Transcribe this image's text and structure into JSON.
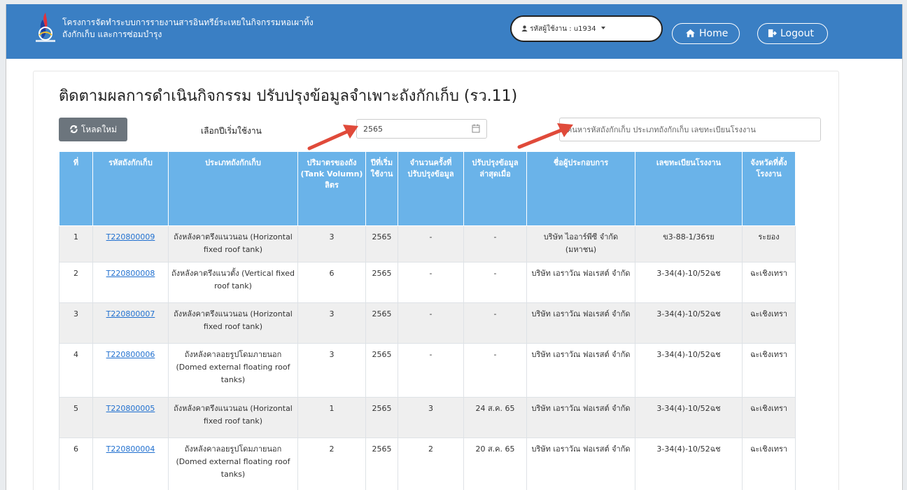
{
  "header": {
    "title_line1": "โครงการจัดทำระบบการรายงานสารอินทรีย์ระเหยในกิจกรรมหอเผาทิ้ง",
    "title_line2": "ถังกักเก็บ และการซ่อมบำรุง",
    "user_label": "รหัสผู้ใช้งาน : u1934",
    "home_label": "Home",
    "logout_label": "Logout",
    "bar_color": "#3a7fc4"
  },
  "page": {
    "title": "ติดตามผลการดำเนินกิจกรรม ปรับปรุงข้อมูลจำเพาะถังกักเก็บ (รว.11)"
  },
  "toolbar": {
    "reload_label": "โหลดใหม่",
    "year_label": "เลือกปีเริ่มใช้งาน",
    "year_value": "2565",
    "search_placeholder": "ค้นหารหัสถังกักเก็บ ประเภทถังกักเก็บ เลขทะเบียนโรงงาน"
  },
  "table": {
    "header_color": "#6ab3e9",
    "columns": [
      "ที่",
      "รหัสถังกักเก็บ",
      "ประเภทถังกักเก็บ",
      "ปริมาตรของถัง (Tank Volumn) ลิตร",
      "ปีที่เริ่มใช้งาน",
      "จำนวนครั้งที่ปรับปรุงข้อมูล",
      "ปรับปรุงข้อมูลล่าสุดเมื่อ",
      "ชื่อผู้ประกอบการ",
      "เลขทะเบียนโรงงาน",
      "จังหวัดที่ตั้งโรงงาน"
    ],
    "rows": [
      {
        "no": "1",
        "code": "T220800009",
        "type": "ถังหลังคาตรึงแนวนอน (Horizontal fixed roof tank)",
        "volume": "3",
        "year": "2565",
        "times": "-",
        "last": "-",
        "company": "บริษัท ไออาร์พีซี จำกัด (มหาชน)",
        "reg": "ข3-88-1/36รย",
        "province": "ระยอง"
      },
      {
        "no": "2",
        "code": "T220800008",
        "type": "ถังหลังคาตรึงแนวตั้ง (Vertical fixed roof tank)",
        "volume": "6",
        "year": "2565",
        "times": "-",
        "last": "-",
        "company": "บริษัท เอราวัณ ฟอเรสต์ จำกัด",
        "reg": "3-34(4)-10/52ฉช",
        "province": "ฉะเชิงเทรา"
      },
      {
        "no": "3",
        "code": "T220800007",
        "type": "ถังหลังคาตรึงแนวนอน (Horizontal fixed roof tank)",
        "volume": "3",
        "year": "2565",
        "times": "-",
        "last": "-",
        "company": "บริษัท เอราวัณ ฟอเรสต์ จำกัด",
        "reg": "3-34(4)-10/52ฉช",
        "province": "ฉะเชิงเทรา"
      },
      {
        "no": "4",
        "code": "T220800006",
        "type": "ถังหลังคาลอยรูปโดมภายนอก (Domed external floating roof tanks)",
        "volume": "3",
        "year": "2565",
        "times": "-",
        "last": "-",
        "company": "บริษัท เอราวัณ ฟอเรสต์ จำกัด",
        "reg": "3-34(4)-10/52ฉช",
        "province": "ฉะเชิงเทรา"
      },
      {
        "no": "5",
        "code": "T220800005",
        "type": "ถังหลังคาตรึงแนวนอน (Horizontal fixed roof tank)",
        "volume": "1",
        "year": "2565",
        "times": "3",
        "last": "24 ส.ค. 65",
        "company": "บริษัท เอราวัณ ฟอเรสต์ จำกัด",
        "reg": "3-34(4)-10/52ฉช",
        "province": "ฉะเชิงเทรา"
      },
      {
        "no": "6",
        "code": "T220800004",
        "type": "ถังหลังคาลอยรูปโดมภายนอก (Domed external floating roof tanks)",
        "volume": "2",
        "year": "2565",
        "times": "2",
        "last": "20 ส.ค. 65",
        "company": "บริษัท เอราวัณ ฟอเรสต์ จำกัด",
        "reg": "3-34(4)-10/52ฉช",
        "province": "ฉะเชิงเทรา"
      }
    ]
  },
  "icons": {
    "reload": "sync-icon",
    "calendar": "calendar-icon",
    "user": "user-icon",
    "home": "home-icon",
    "logout": "logout-icon"
  },
  "annotation_color": "#e04a3a"
}
